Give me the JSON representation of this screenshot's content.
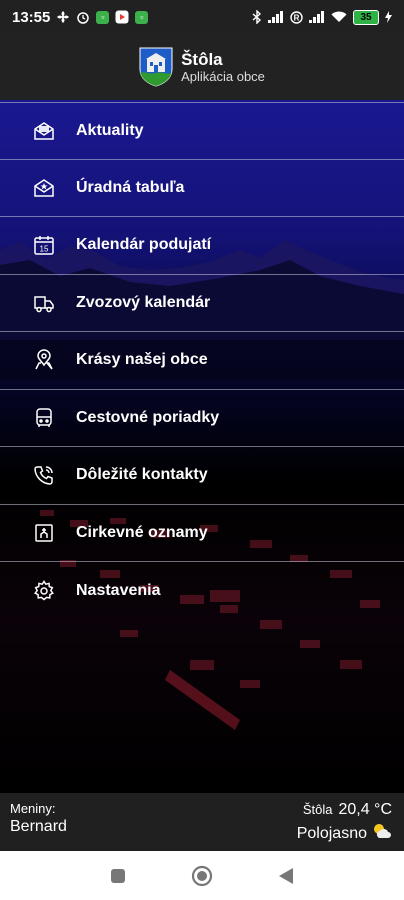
{
  "statusbar": {
    "time": "13:55",
    "battery": "35"
  },
  "header": {
    "title": "Štôla",
    "subtitle": "Aplikácia obce"
  },
  "menu": [
    {
      "label": "Aktuality",
      "icon": "open-envelope-icon"
    },
    {
      "label": "Úradná tabuľa",
      "icon": "mail-star-icon"
    },
    {
      "label": "Kalendár podujatí",
      "icon": "calendar-icon"
    },
    {
      "label": "Zvozový kalendár",
      "icon": "garbage-truck-icon"
    },
    {
      "label": "Krásy našej obce",
      "icon": "map-pin-icon"
    },
    {
      "label": "Cestovné poriadky",
      "icon": "bus-icon"
    },
    {
      "label": "Dôležité kontakty",
      "icon": "phone-icon"
    },
    {
      "label": "Cirkevné oznamy",
      "icon": "church-icon"
    },
    {
      "label": "Nastavenia",
      "icon": "gear-icon"
    }
  ],
  "footer": {
    "nameday_label": "Meniny:",
    "nameday_name": "Bernard",
    "town": "Štôla",
    "temperature": "20,4 °C",
    "condition": "Polojasno"
  },
  "colors": {
    "menu_bg_top": "#1a1890",
    "bar_bg": "#212121"
  }
}
